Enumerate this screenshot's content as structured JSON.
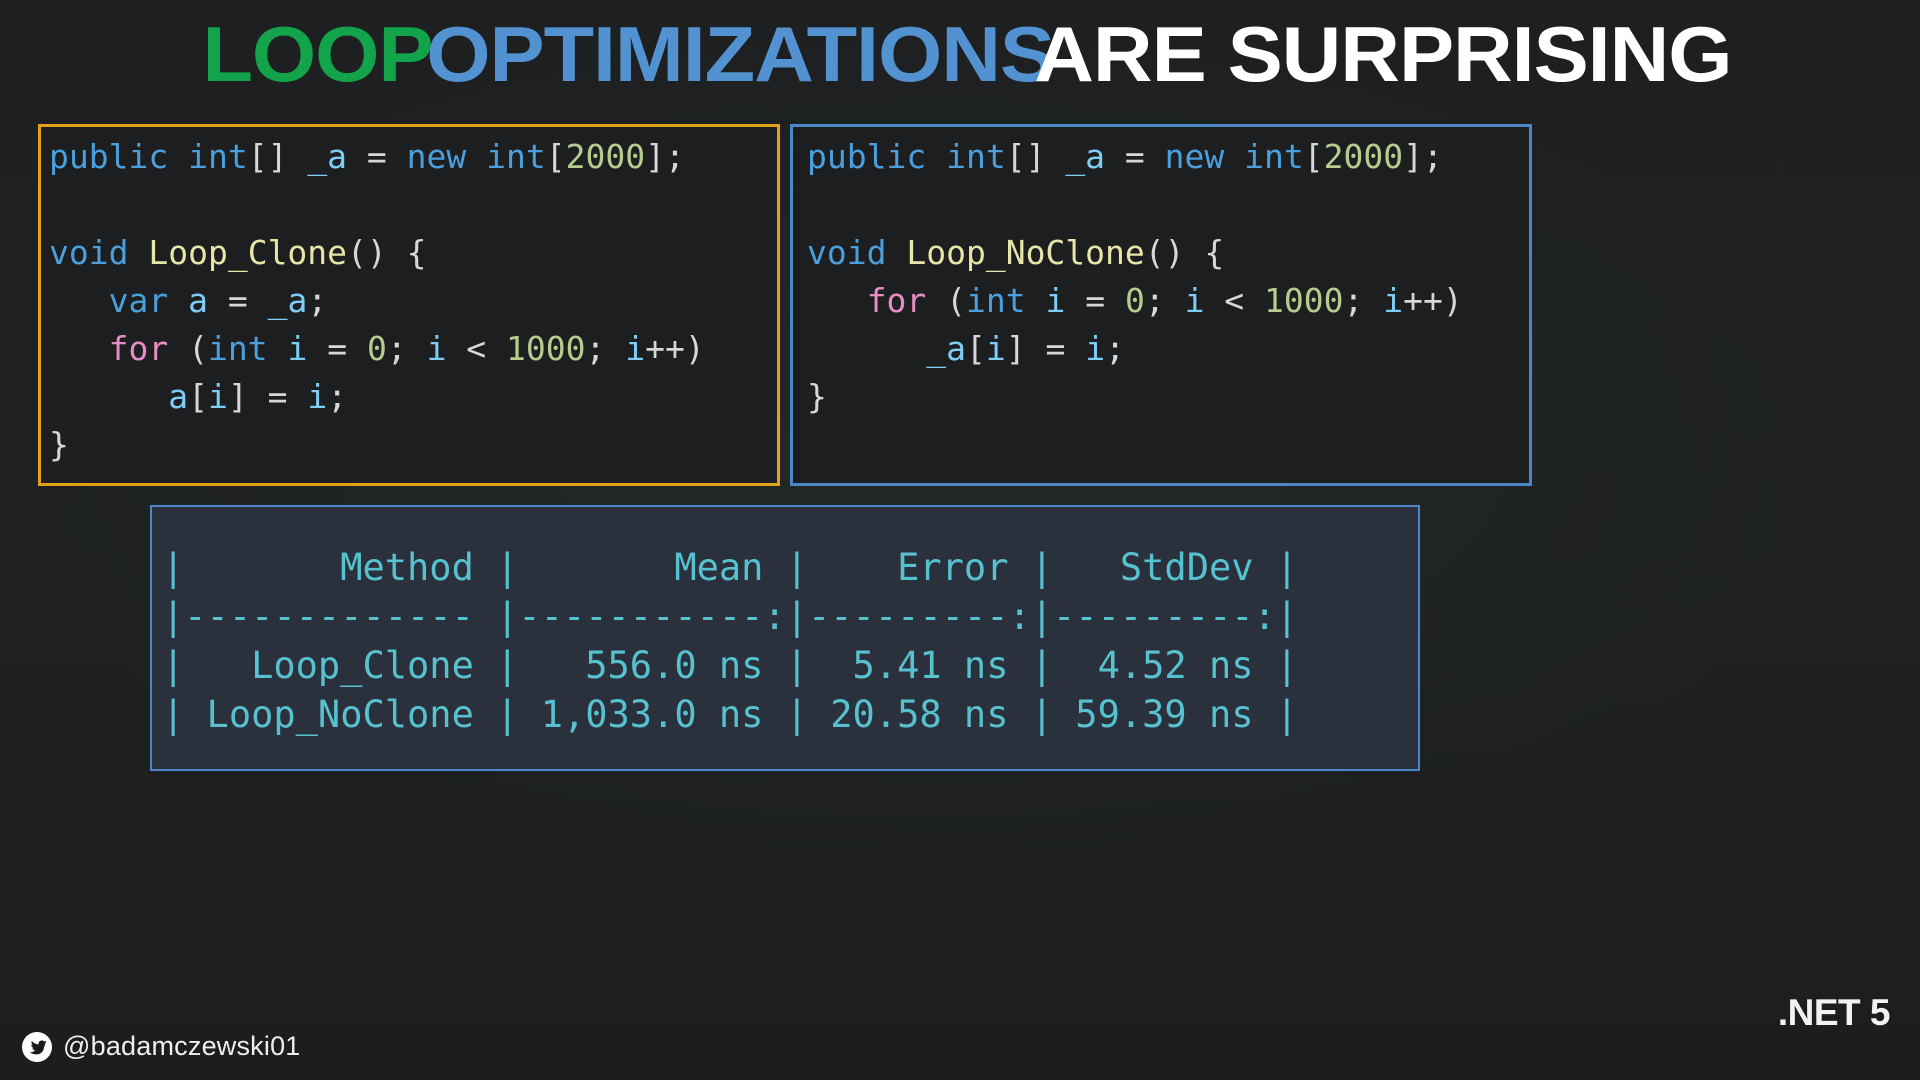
{
  "slide": {
    "background_color": "#1e2022",
    "title": {
      "word_green": "LOOP",
      "word_blue": "OPTIMIZATIONS",
      "word_white": "ARE SURPRISING"
    },
    "colors": {
      "green": "#12a34b",
      "blue": "#5292d0",
      "white": "#ffffff",
      "gold_border": "#e0a216",
      "panel_blue_border": "#4a86c8",
      "table_text_cyan": "#57c2cf",
      "table_panel_bg": "#2b313c",
      "code_panel_bg": "#1c1e20"
    }
  },
  "code_left": {
    "border_color": "#e0a216",
    "lines": [
      [
        {
          "t": "public",
          "c": "k"
        },
        {
          "t": " ",
          "c": "p"
        },
        {
          "t": "int",
          "c": "k"
        },
        {
          "t": "[] ",
          "c": "p"
        },
        {
          "t": "_a",
          "c": "id"
        },
        {
          "t": " = ",
          "c": "p"
        },
        {
          "t": "new",
          "c": "k"
        },
        {
          "t": " ",
          "c": "p"
        },
        {
          "t": "int",
          "c": "k"
        },
        {
          "t": "[",
          "c": "p"
        },
        {
          "t": "2000",
          "c": "num"
        },
        {
          "t": "];",
          "c": "p"
        }
      ],
      [
        {
          "t": "",
          "c": "p"
        }
      ],
      [
        {
          "t": "void",
          "c": "k"
        },
        {
          "t": " ",
          "c": "p"
        },
        {
          "t": "Loop_Clone",
          "c": "fn"
        },
        {
          "t": "() {",
          "c": "p"
        }
      ],
      [
        {
          "t": "   ",
          "c": "p"
        },
        {
          "t": "var",
          "c": "k"
        },
        {
          "t": " ",
          "c": "p"
        },
        {
          "t": "a",
          "c": "id"
        },
        {
          "t": " = ",
          "c": "p"
        },
        {
          "t": "_a",
          "c": "id"
        },
        {
          "t": ";",
          "c": "p"
        }
      ],
      [
        {
          "t": "   ",
          "c": "p"
        },
        {
          "t": "for",
          "c": "kw2"
        },
        {
          "t": " (",
          "c": "p"
        },
        {
          "t": "int",
          "c": "k"
        },
        {
          "t": " ",
          "c": "p"
        },
        {
          "t": "i",
          "c": "id"
        },
        {
          "t": " = ",
          "c": "p"
        },
        {
          "t": "0",
          "c": "num"
        },
        {
          "t": "; ",
          "c": "p"
        },
        {
          "t": "i",
          "c": "id"
        },
        {
          "t": " < ",
          "c": "p"
        },
        {
          "t": "1000",
          "c": "num"
        },
        {
          "t": "; ",
          "c": "p"
        },
        {
          "t": "i",
          "c": "id"
        },
        {
          "t": "++)",
          "c": "p"
        }
      ],
      [
        {
          "t": "      ",
          "c": "p"
        },
        {
          "t": "a",
          "c": "id"
        },
        {
          "t": "[",
          "c": "p"
        },
        {
          "t": "i",
          "c": "id"
        },
        {
          "t": "] = ",
          "c": "p"
        },
        {
          "t": "i",
          "c": "id"
        },
        {
          "t": ";",
          "c": "p"
        }
      ],
      [
        {
          "t": "}",
          "c": "p"
        }
      ]
    ]
  },
  "code_right": {
    "border_color": "#4a86c8",
    "lines": [
      [
        {
          "t": "public",
          "c": "k"
        },
        {
          "t": " ",
          "c": "p"
        },
        {
          "t": "int",
          "c": "k"
        },
        {
          "t": "[] ",
          "c": "p"
        },
        {
          "t": "_a",
          "c": "id"
        },
        {
          "t": " = ",
          "c": "p"
        },
        {
          "t": "new",
          "c": "k"
        },
        {
          "t": " ",
          "c": "p"
        },
        {
          "t": "int",
          "c": "k"
        },
        {
          "t": "[",
          "c": "p"
        },
        {
          "t": "2000",
          "c": "num"
        },
        {
          "t": "];",
          "c": "p"
        }
      ],
      [
        {
          "t": "",
          "c": "p"
        }
      ],
      [
        {
          "t": "void",
          "c": "k"
        },
        {
          "t": " ",
          "c": "p"
        },
        {
          "t": "Loop_NoClone",
          "c": "fn"
        },
        {
          "t": "() {",
          "c": "p"
        }
      ],
      [
        {
          "t": "   ",
          "c": "p"
        },
        {
          "t": "for",
          "c": "kw2"
        },
        {
          "t": " (",
          "c": "p"
        },
        {
          "t": "int",
          "c": "k"
        },
        {
          "t": " ",
          "c": "p"
        },
        {
          "t": "i",
          "c": "id"
        },
        {
          "t": " = ",
          "c": "p"
        },
        {
          "t": "0",
          "c": "num"
        },
        {
          "t": "; ",
          "c": "p"
        },
        {
          "t": "i",
          "c": "id"
        },
        {
          "t": " < ",
          "c": "p"
        },
        {
          "t": "1000",
          "c": "num"
        },
        {
          "t": "; ",
          "c": "p"
        },
        {
          "t": "i",
          "c": "id"
        },
        {
          "t": "++)",
          "c": "p"
        }
      ],
      [
        {
          "t": "      ",
          "c": "p"
        },
        {
          "t": "_a",
          "c": "id"
        },
        {
          "t": "[",
          "c": "p"
        },
        {
          "t": "i",
          "c": "id"
        },
        {
          "t": "] = ",
          "c": "p"
        },
        {
          "t": "i",
          "c": "id"
        },
        {
          "t": ";",
          "c": "p"
        }
      ],
      [
        {
          "t": "}",
          "c": "p"
        }
      ]
    ]
  },
  "benchmark": {
    "columns": [
      "Method",
      "Mean",
      "Error",
      "StdDev"
    ],
    "alignment": [
      "right",
      "right",
      "right",
      "right"
    ],
    "rows": [
      {
        "Method": "Loop_Clone",
        "Mean": "556.0 ns",
        "Error": "5.41 ns",
        "StdDev": "4.52 ns"
      },
      {
        "Method": "Loop_NoClone",
        "Mean": "1,033.0 ns",
        "Error": "20.58 ns",
        "StdDev": "59.39 ns"
      }
    ],
    "rendered_text": "|       Method |       Mean |    Error |   StdDev |\n|------------- |-----------:|---------:|---------:|\n|   Loop_Clone |   556.0 ns |  5.41 ns |  4.52 ns |\n| Loop_NoClone | 1,033.0 ns | 20.58 ns | 59.39 ns |"
  },
  "footer": {
    "twitter_handle": "@badamczewski01",
    "twitter_icon": "twitter-bird-icon",
    "runtime_badge": ".NET 5"
  }
}
